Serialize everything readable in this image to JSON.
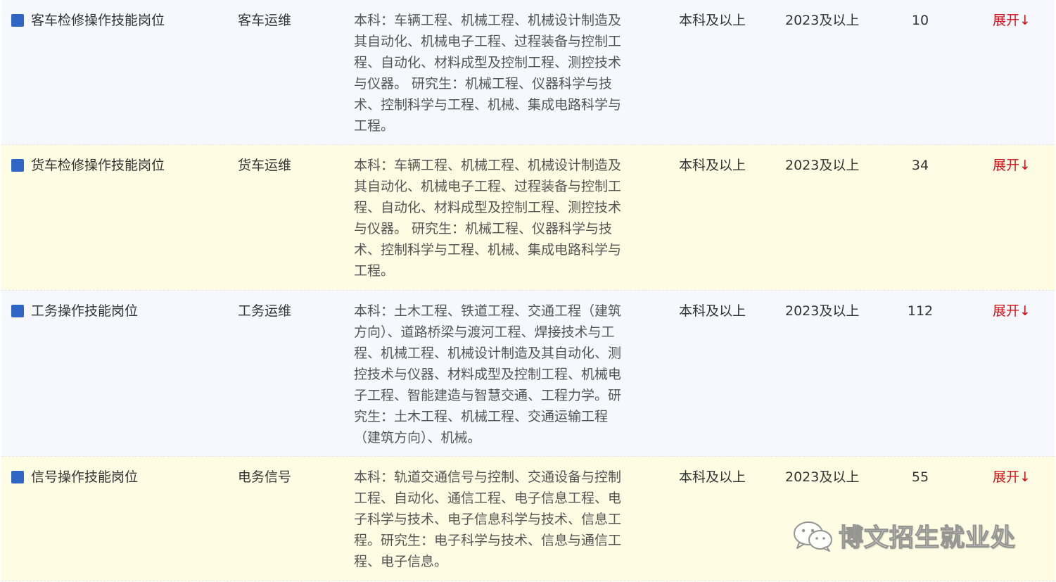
{
  "rows": [
    {
      "name": "客车检修操作技能岗位",
      "dept": "客车运维",
      "requirement": "本科：车辆工程、机械工程、机械设计制造及\n其自动化、机械电子工程、过程装备与控制工\n程、自动化、材料成型及控制工程、测控技术\n与仪器。 研究生：机械工程、仪器科学与技\n术、控制科学与工程、机械、集成电路科学与\n工程。",
      "degree": "本科及以上",
      "year": "2023及以上",
      "count": "10",
      "expand": "展开↓"
    },
    {
      "name": "货车检修操作技能岗位",
      "dept": "货车运维",
      "requirement": "本科：车辆工程、机械工程、机械设计制造及\n其自动化、机械电子工程、过程装备与控制工\n程、自动化、材料成型及控制工程、测控技术\n与仪器。 研究生：机械工程、仪器科学与技\n术、控制科学与工程、机械、集成电路科学与\n工程。",
      "degree": "本科及以上",
      "year": "2023及以上",
      "count": "34",
      "expand": "展开↓"
    },
    {
      "name": "工务操作技能岗位",
      "dept": "工务运维",
      "requirement": "本科：土木工程、铁道工程、交通工程（建筑\n方向）、道路桥梁与渡河工程、焊接技术与工\n程、机械工程、机械设计制造及其自动化、测\n控技术与仪器、材料成型及控制工程、机械电\n子工程、智能建造与智慧交通、工程力学。研\n究生：土木工程、机械工程、交通运输工程\n（建筑方向）、机械。",
      "degree": "本科及以上",
      "year": "2023及以上",
      "count": "112",
      "expand": "展开↓"
    },
    {
      "name": "信号操作技能岗位",
      "dept": "电务信号",
      "requirement": "本科：轨道交通信号与控制、交通设备与控制\n工程、自动化、通信工程、电子信息工程、电\n子科学与技术、电子信息科学与技术、信息工\n程。研究生：电子科学与技术、信息与通信工\n程、电子信息。",
      "degree": "本科及以上",
      "year": "2023及以上",
      "count": "55",
      "expand": "展开↓"
    }
  ],
  "watermark": {
    "icon": "wechat-icon",
    "text": "博文招生就业处"
  },
  "colors": {
    "row_odd": "#f6f8fd",
    "row_even": "#fefde3",
    "icon_blue": "#2f66c4",
    "expand_red": "#d0121b"
  }
}
